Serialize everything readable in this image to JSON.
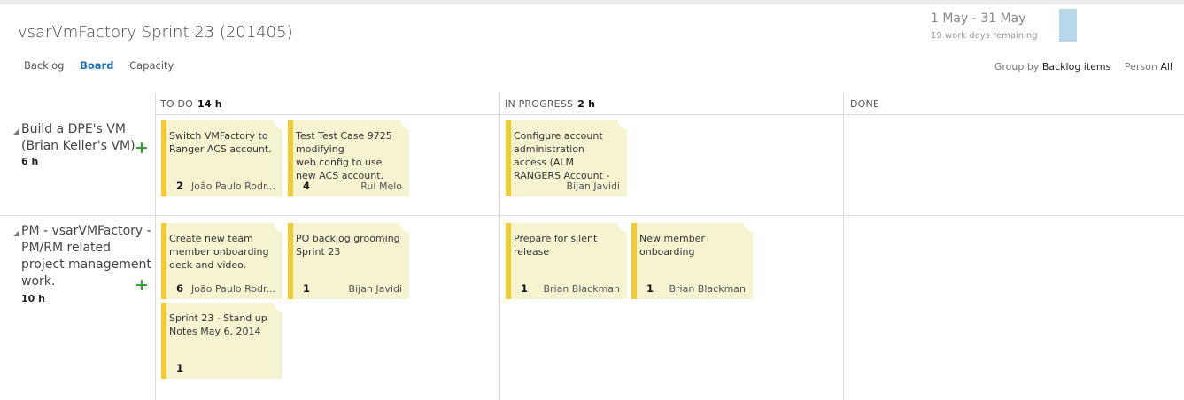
{
  "header": {
    "title": "vsarVmFactory Sprint 23 (201405)",
    "date_range": "1 May - 31 May",
    "remaining": "19 work days remaining"
  },
  "nav": {
    "backlog": "Backlog",
    "board": "Board",
    "capacity": "Capacity"
  },
  "group_by": {
    "label": "Group by",
    "value": "Backlog items",
    "person_label": "Person",
    "person_value": "All"
  },
  "columns": [
    {
      "name": "TO DO",
      "hours": "14 h"
    },
    {
      "name": "IN PROGRESS",
      "hours": "2 h"
    },
    {
      "name": "DONE",
      "hours": ""
    }
  ],
  "rows": [
    {
      "title": "Build a DPE's VM (Brian Keller's VM)",
      "hours": "6 h",
      "cards": [
        {
          "title": "Switch VMFactory to Ranger ACS account.",
          "estimate": "2",
          "owner": "João Paulo Rodr..."
        },
        {
          "title": "Test Test Case 9725 modifying web.config to use new ACS account.",
          "estimate": "4",
          "owner": "Rui Melo"
        },
        {
          "title": "Configure account administration access (ALM RANGERS Account - ",
          "estimate": "",
          "owner": "Bijan Javidi"
        }
      ]
    },
    {
      "title": "PM - vsarVMFactory - PM/RM related project management work.",
      "hours": "10 h",
      "cards": [
        {
          "title": "Create new team member onboarding deck and video.",
          "estimate": "6",
          "owner": "João Paulo Rodr..."
        },
        {
          "title": "PO backlog grooming Sprint 23",
          "estimate": "1",
          "owner": "Bijan Javidi"
        },
        {
          "title": "Sprint 23 - Stand up Notes May 6, 2014",
          "estimate": "1",
          "owner": ""
        },
        {
          "title": "Prepare for silent release",
          "estimate": "1",
          "owner": "Brian Blackman"
        },
        {
          "title": "New member onboarding",
          "estimate": "1",
          "owner": "Brian Blackman"
        }
      ]
    }
  ],
  "colors": {
    "card_bg": "#f6f3d0",
    "card_stripe": "#f2cc2e",
    "accent": "#1d72b8",
    "add": "#3b9a3b"
  },
  "icons": {
    "add": "plus-icon",
    "expand": "expander-icon"
  }
}
